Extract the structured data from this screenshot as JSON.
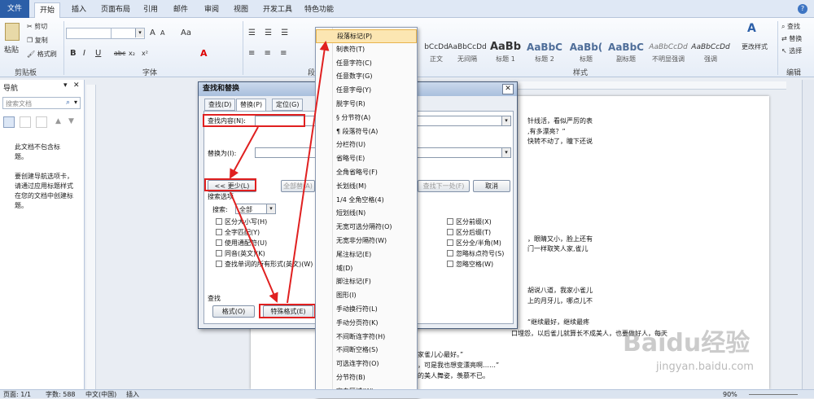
{
  "ribbon_tabs": [
    "文件",
    "开始",
    "插入",
    "页面布局",
    "引用",
    "邮件",
    "审阅",
    "视图",
    "开发工具",
    "特色功能"
  ],
  "clipboard": {
    "paste": "粘贴",
    "cut": "剪切",
    "copy": "复制",
    "format_painter": "格式刷",
    "group": "剪贴板"
  },
  "font": {
    "size_label": "A",
    "aa": "Aa",
    "bold": "B",
    "italic": "I",
    "underline": "U",
    "strike": "abc",
    "sub": "x₂",
    "sup": "x²",
    "group": "字体"
  },
  "paragraph": {
    "group": "段落",
    "partial": "段"
  },
  "styles": {
    "items": [
      {
        "preview": "bCcDd",
        "name": "正文"
      },
      {
        "preview": "AaBbCcDd",
        "name": "无间隔"
      },
      {
        "preview": "AaBb",
        "name": "标题 1"
      },
      {
        "preview": "AaBbC",
        "name": "标题 2"
      },
      {
        "preview": "AaBb(",
        "name": "标题"
      },
      {
        "preview": "AaBbC",
        "name": "副标题"
      },
      {
        "preview": "AaBbCcDd",
        "name": "不明显强调"
      },
      {
        "preview": "AaBbCcDd",
        "name": "强调"
      }
    ],
    "change": "更改样式",
    "group": "样式"
  },
  "editing": {
    "find": "查找",
    "replace": "替换",
    "select": "选择",
    "group": "编辑"
  },
  "nav": {
    "title": "导航",
    "search_placeholder": "搜索文档",
    "no_headings": "此文档不包含标题。",
    "hint": "要创建导航选项卡，请通过应用标题样式在您的文档中创建标题。"
  },
  "dialog": {
    "title": "查找和替换",
    "tabs": [
      "查找(D)",
      "替换(P)",
      "定位(G)"
    ],
    "find_label": "查找内容(N):",
    "replace_label": "替换为(I):",
    "less_button": "<< 更少(L)",
    "replace_all": "全部替(A)",
    "find_next": "查找下一处(F)",
    "cancel": "取消",
    "search_options": "搜索选项",
    "search_label": "搜索:",
    "search_value": "全部",
    "options_left": [
      "区分大小写(H)",
      "全字匹配(Y)",
      "使用通配符(U)",
      "同音(英文)(K)",
      "查找单词的所有形式(英文)(W)"
    ],
    "options_right": [
      "区分前缀(X)",
      "区分后缀(T)",
      "区分全/半角(M)",
      "忽略标点符号(S)",
      "忽略空格(W)"
    ],
    "find_section": "查找",
    "format_button": "格式(O)",
    "special_button": "特殊格式(E)"
  },
  "special_menu": [
    "段落标记(P)",
    "制表符(T)",
    "任意字符(C)",
    "任意数字(G)",
    "任意字母(Y)",
    "脱字号(R)",
    "§ 分节符(A)",
    "¶ 段落符号(A)",
    "分栏符(U)",
    "省略号(E)",
    "全角省略号(F)",
    "长划线(M)",
    "1/4 全角空格(4)",
    "短划线(N)",
    "无宽可选分隔符(O)",
    "无宽非分隔符(W)",
    "尾注标记(E)",
    "域(D)",
    "脚注标记(F)",
    "图形(I)",
    "手动换行符(L)",
    "手动分页符(K)",
    "不间断连字符(H)",
    "不间断空格(S)",
    "可选连字符(O)",
    "分节符(B)",
    "空白区域(W)"
  ],
  "document_lines": [
    "针线活，看似严厉的表",
    ",有多漂亮？”",
    "快转不动了，瞳下还说",
    "，眼睛又小，脸上还有",
    "门一样取笑人家,雀儿",
    "胡说八道，我家小雀儿",
    "上的月牙儿，哪点儿不",
    "“继续最好，继续最疼",
    "口埋怨，以后雀儿就算长不成美人，也要做好人，每天",
    "家雀儿心最好。”",
    "，可是我也想变漂亮啊……”",
    "的美人舞姿，羡慕不已。"
  ],
  "status": {
    "page": "页面: 1/1",
    "words": "字数: 588",
    "lang": "中文(中国)",
    "mode": "插入",
    "zoom": "90%"
  },
  "watermark": {
    "brand": "Baidu经验",
    "url": "jingyan.baidu.com"
  }
}
